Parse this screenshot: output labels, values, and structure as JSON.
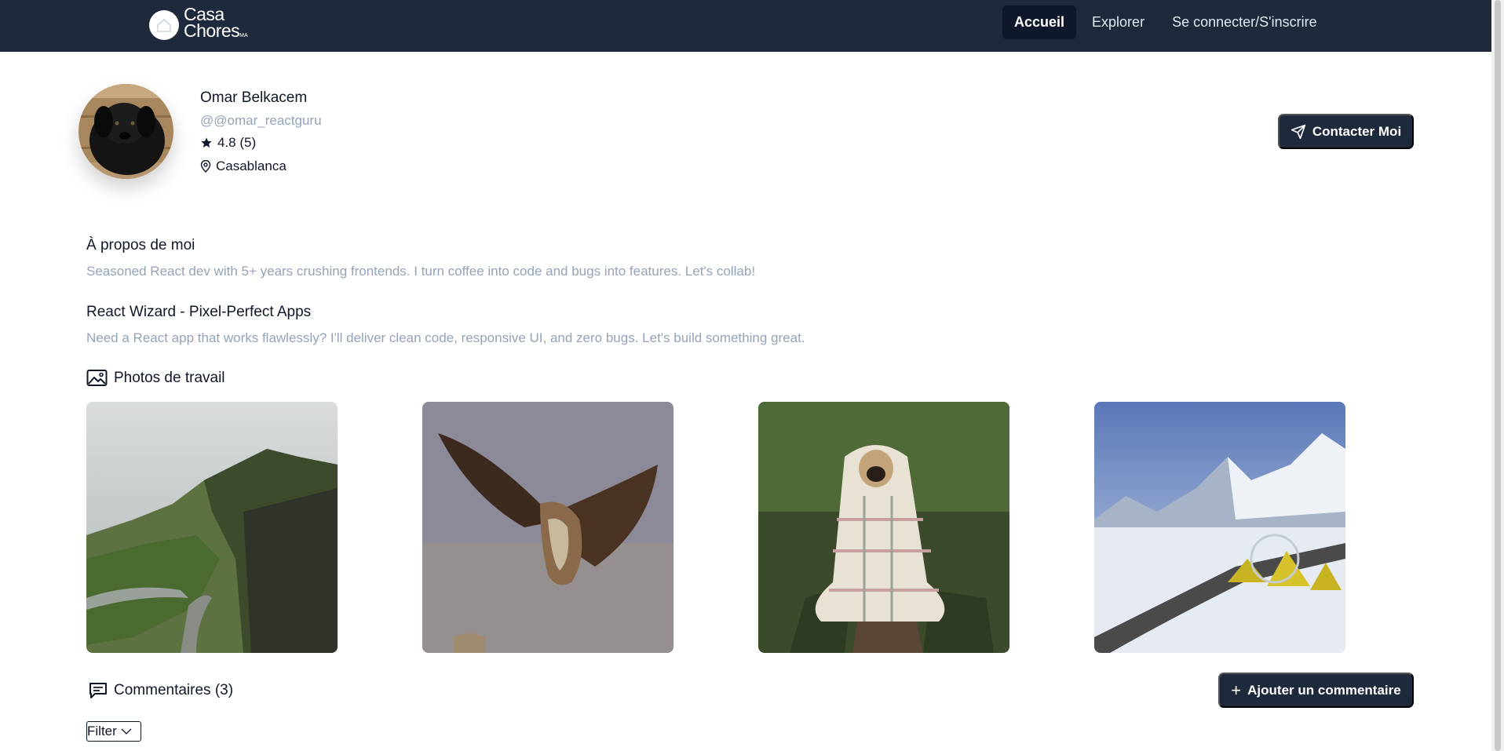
{
  "navbar": {
    "logo_line1": "Casa",
    "logo_line2": "Chores",
    "logo_suffix": "MA",
    "links": [
      {
        "label": "Accueil",
        "active": true
      },
      {
        "label": "Explorer",
        "active": false
      },
      {
        "label": "Se connecter/S'inscrire",
        "active": false
      }
    ]
  },
  "profile": {
    "name": "Omar Belkacem",
    "handle": "@@omar_reactguru",
    "rating": "4.8 (5)",
    "location": "Casablanca",
    "contact_label": "Contacter Moi",
    "avatar_icon": "dog-photo"
  },
  "about": {
    "title": "À propos de moi",
    "text": "Seasoned React dev with 5+ years crushing frontends. I turn coffee into code and bugs into features. Let's collab!"
  },
  "gig": {
    "title": "React Wizard - Pixel-Perfect Apps",
    "text": "Need a React app that works flawlessly? I'll deliver clean code, responsive UI, and zero bugs. Let's build something great."
  },
  "photos": {
    "title": "Photos de travail",
    "items": [
      "mountain-landscape-photo",
      "eagle-photo",
      "pug-in-blanket-photo",
      "snowy-mountain-camp-photo"
    ]
  },
  "comments": {
    "title": "Commentaires (3)",
    "add_label": "Ajouter un commentaire",
    "filter_label": "Filter"
  },
  "colors": {
    "navbar": "#1e293b",
    "button": "#1e293b",
    "muted_text": "#94a3b8"
  }
}
